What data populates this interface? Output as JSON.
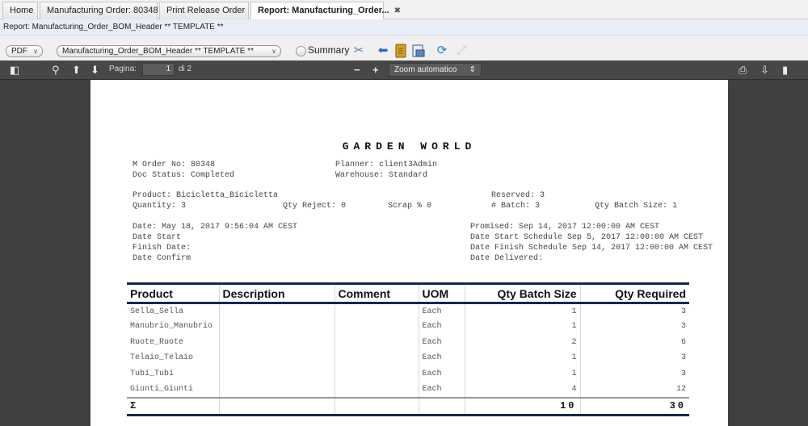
{
  "tabs": [
    {
      "label": "Home",
      "closable": false
    },
    {
      "label": "Manufacturing Order: 80348",
      "closable": true
    },
    {
      "label": "Print Release Order",
      "closable": true
    },
    {
      "label": "Report: Manufacturing_Order...",
      "closable": true,
      "active": true
    }
  ],
  "window_title": "Report: Manufacturing_Order_BOM_Header ** TEMPLATE **",
  "toolbar": {
    "format_value": "PDF",
    "report_value": "Manufacturing_Order_BOM_Header ** TEMPLATE **",
    "summary_label": "Summary",
    "summary_checked": false
  },
  "pdf_viewer": {
    "page_label": "Pagina:",
    "page_current": "1",
    "page_total_text": "di 2",
    "zoom_value": "Zoom automatico"
  },
  "report": {
    "company": "GARDEN WORLD",
    "header_lines": [
      "M Order No: 80348",
      "Doc Status: Completed",
      "Planner: client3Admin",
      "Warehouse: Standard",
      "Product: Bicicletta_Bicicletta",
      "Reserved: 3",
      "Quantity: 3",
      "Qty Reject: 0",
      "Scrap % 0",
      "# Batch: 3",
      "Qty Batch Size: 1",
      "Date: May 18, 2017 9:56:04 AM CEST",
      "Date Start",
      "Finish Date:",
      "Date Confirm",
      "Promised: Sep 14, 2017 12:00:00 AM CEST",
      "Date Start Schedule Sep 5, 2017 12:00:00 AM CEST",
      "Date Finish Schedule Sep 14, 2017 12:00:00 AM CEST",
      "Date Delivered:"
    ],
    "columns": [
      "Product",
      "Description",
      "Comment",
      "UOM",
      "Qty Batch Size",
      "Qty Required"
    ],
    "rows": [
      [
        "Sella_Sella",
        "",
        "",
        "Each",
        "1",
        "3"
      ],
      [
        "Manubrio_Manubrio",
        "",
        "",
        "Each",
        "1",
        "3"
      ],
      [
        "Ruote_Ruote",
        "",
        "",
        "Each",
        "2",
        "6"
      ],
      [
        "Telaio_Telaio",
        "",
        "",
        "Each",
        "1",
        "3"
      ],
      [
        "Tubi_Tubi",
        "",
        "",
        "Each",
        "1",
        "3"
      ],
      [
        "Giunti_Giunti",
        "",
        "",
        "Each",
        "4",
        "12"
      ]
    ],
    "total_symbol": "Σ",
    "total_batch": "10",
    "total_required": "30"
  },
  "icons": [
    "process-icon",
    "archive-icon",
    "export-icon",
    "print-preview-icon",
    "refresh-icon",
    "zoom-across-icon",
    "sidebar-toggle-icon",
    "find-icon",
    "prev-page-icon",
    "next-page-icon",
    "zoom-out-icon",
    "zoom-in-icon",
    "print-icon",
    "download-icon",
    "bookmark-icon",
    "close-tab-icon"
  ]
}
